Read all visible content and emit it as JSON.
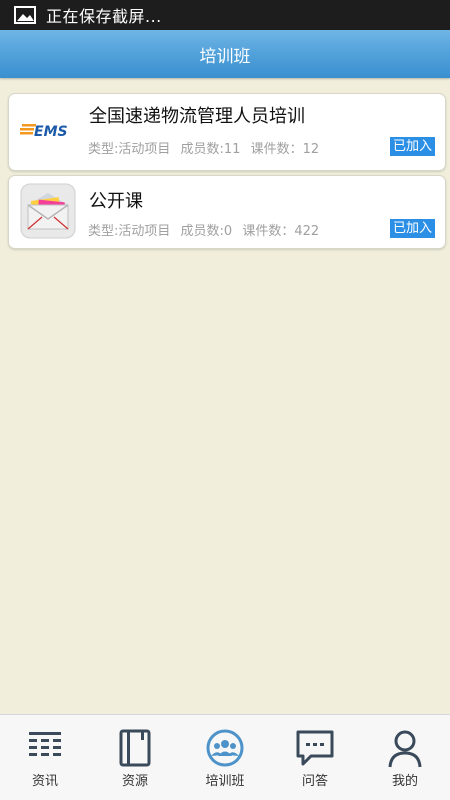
{
  "status_bar": {
    "text": "正在保存截屏..."
  },
  "header": {
    "title": "培训班"
  },
  "courses": [
    {
      "logo": "ems-logo",
      "title": "全国速递物流管理人员培训",
      "type": "类型:活动项目",
      "members": "成员数:11",
      "lessons": "课件数：12",
      "badge": "已加入"
    },
    {
      "logo": "envelope-icon",
      "title": "公开课",
      "type": "类型:活动项目",
      "members": "成员数:0",
      "lessons": "课件数：422",
      "badge": "已加入"
    }
  ],
  "tabs": [
    {
      "label": "资讯",
      "icon": "news-icon"
    },
    {
      "label": "资源",
      "icon": "book-icon"
    },
    {
      "label": "培训班",
      "icon": "group-icon",
      "active": true
    },
    {
      "label": "问答",
      "icon": "chat-icon"
    },
    {
      "label": "我的",
      "icon": "user-icon"
    }
  ],
  "colors": {
    "accent": "#2b8fe6",
    "header": "#4f9fd9",
    "background": "#f1efdc",
    "tab_icon": "#3a4a5a",
    "active_tab_icon": "#4d93c9"
  }
}
